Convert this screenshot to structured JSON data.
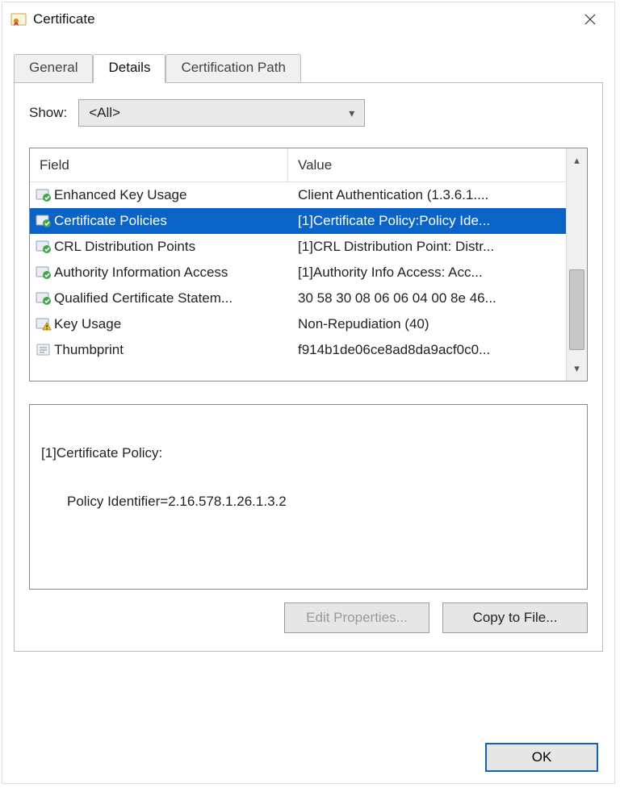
{
  "window": {
    "title": "Certificate"
  },
  "tabs": [
    {
      "label": "General",
      "active": false
    },
    {
      "label": "Details",
      "active": true
    },
    {
      "label": "Certification Path",
      "active": false
    }
  ],
  "show": {
    "label": "Show:",
    "value": "<All>"
  },
  "list": {
    "headers": {
      "field": "Field",
      "value": "Value"
    },
    "rows": [
      {
        "icon": "ext-green",
        "field": "Enhanced Key Usage",
        "value": "Client Authentication (1.3.6.1....",
        "selected": false
      },
      {
        "icon": "ext-green",
        "field": "Certificate Policies",
        "value": "[1]Certificate Policy:Policy Ide...",
        "selected": true
      },
      {
        "icon": "ext-green",
        "field": "CRL Distribution Points",
        "value": "[1]CRL Distribution Point: Distr...",
        "selected": false
      },
      {
        "icon": "ext-green",
        "field": "Authority Information Access",
        "value": "[1]Authority Info Access: Acc...",
        "selected": false
      },
      {
        "icon": "ext-green",
        "field": "Qualified Certificate Statem...",
        "value": "30 58 30 08 06 06 04 00 8e 46...",
        "selected": false
      },
      {
        "icon": "ext-warn",
        "field": "Key Usage",
        "value": "Non-Repudiation (40)",
        "selected": false
      },
      {
        "icon": "ext-plain",
        "field": "Thumbprint",
        "value": "f914b1de06ce8ad8da9acf0c0...",
        "selected": false
      }
    ]
  },
  "detail": {
    "line1": "[1]Certificate Policy:",
    "line2": "Policy Identifier=2.16.578.1.26.1.3.2"
  },
  "buttons": {
    "edit": "Edit Properties...",
    "copy": "Copy to File...",
    "ok": "OK"
  }
}
